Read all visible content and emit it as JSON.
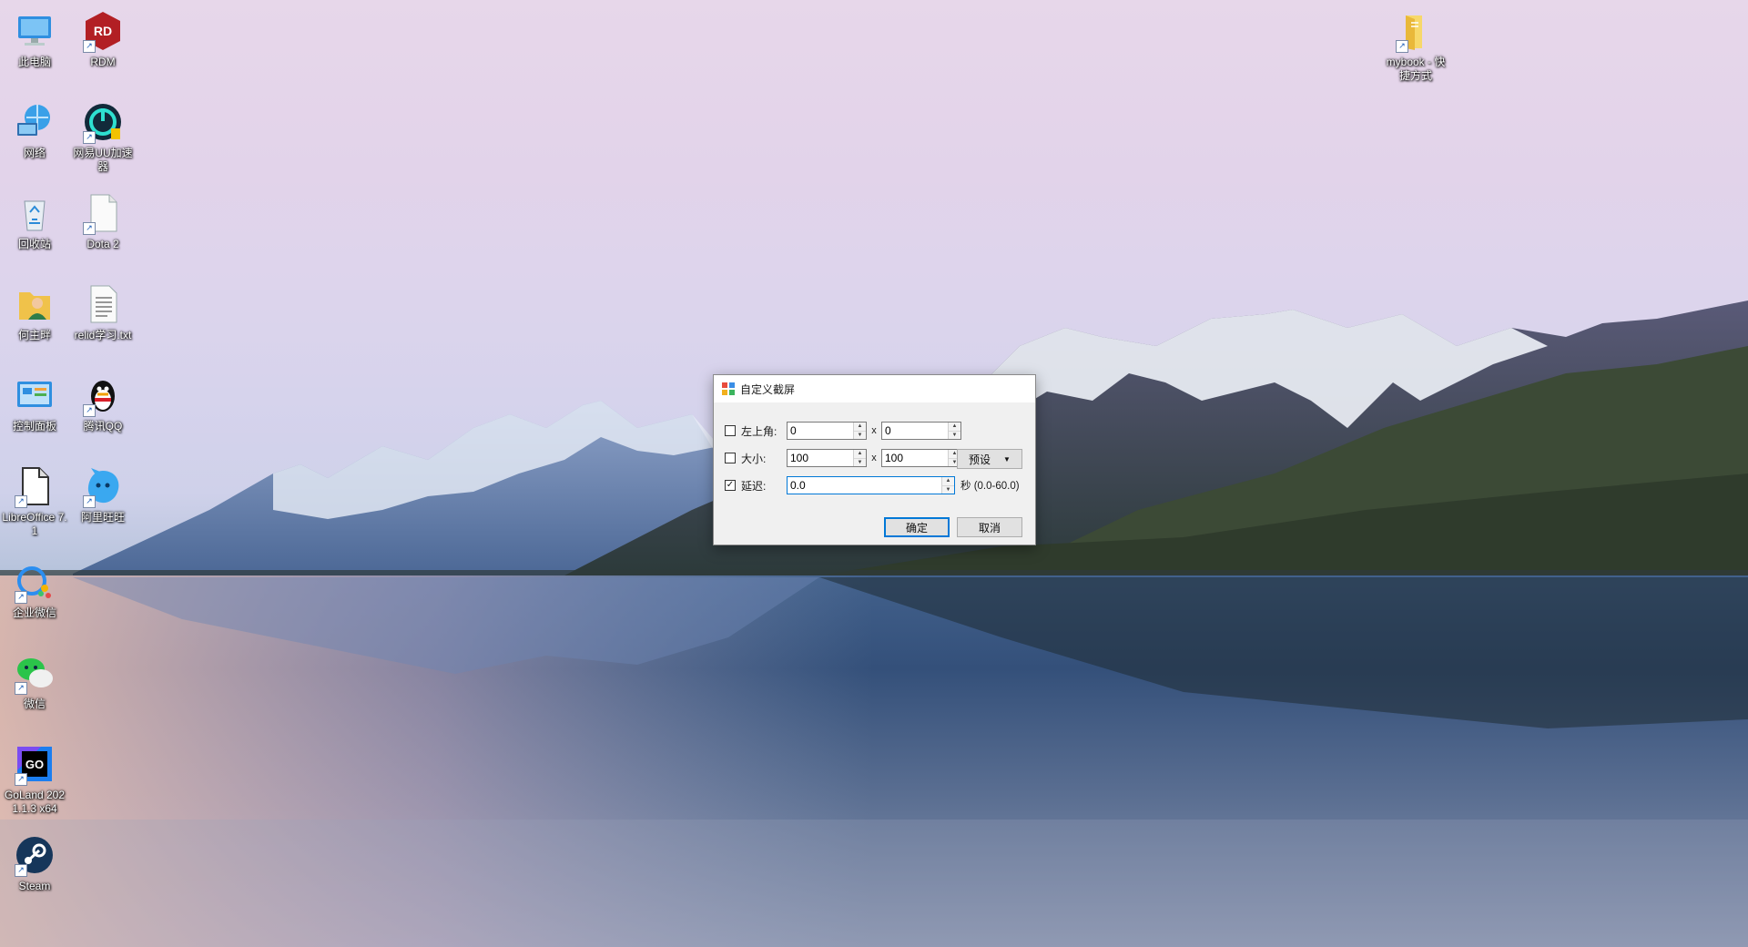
{
  "desktop": {
    "icons": [
      {
        "key": "this-pc",
        "label": "此电脑",
        "icon": "computer-icon",
        "shortcut": false
      },
      {
        "key": "rdm",
        "label": "RDM",
        "icon": "rdm-icon",
        "shortcut": true
      },
      {
        "key": "network",
        "label": "网络",
        "icon": "network-icon",
        "shortcut": false
      },
      {
        "key": "uu",
        "label": "网易UU加速器",
        "icon": "uu-accelerator-icon",
        "shortcut": true
      },
      {
        "key": "recycle-bin",
        "label": "回收站",
        "icon": "recycle-bin-icon",
        "shortcut": false
      },
      {
        "key": "dota2",
        "label": "Dota 2",
        "icon": "blank-file-icon",
        "shortcut": true
      },
      {
        "key": "user-folder",
        "label": "何主畔",
        "icon": "user-folder-icon",
        "shortcut": false
      },
      {
        "key": "relidx",
        "label": "relid学习.txt",
        "icon": "text-file-icon",
        "shortcut": false
      },
      {
        "key": "control-panel",
        "label": "控制面板",
        "icon": "control-panel-icon",
        "shortcut": false
      },
      {
        "key": "qq",
        "label": "腾讯QQ",
        "icon": "qq-penguin-icon",
        "shortcut": true
      },
      {
        "key": "libreoffice",
        "label": "LibreOffice 7.1",
        "icon": "libreoffice-icon",
        "shortcut": true
      },
      {
        "key": "aliwangwang",
        "label": "阿里旺旺",
        "icon": "aliwangwang-icon",
        "shortcut": true
      },
      {
        "key": "wecom",
        "label": "企业微信",
        "icon": "wecom-icon",
        "shortcut": true
      },
      {
        "key": "wechat",
        "label": "微信",
        "icon": "wechat-icon",
        "shortcut": true
      },
      {
        "key": "goland",
        "label": "GoLand 2021.1.3 x64",
        "icon": "goland-icon",
        "shortcut": true
      },
      {
        "key": "steam",
        "label": "Steam",
        "icon": "steam-icon",
        "shortcut": true
      },
      {
        "key": "mybook",
        "label": "mybook - 快捷方式",
        "icon": "folder-icon",
        "shortcut": true
      }
    ]
  },
  "dialog": {
    "title": "自定义截屏",
    "top_left": {
      "label": "左上角:",
      "checked": false,
      "x": "0",
      "y": "0"
    },
    "size": {
      "label": "大小:",
      "checked": false,
      "width": "100",
      "height": "100"
    },
    "delay": {
      "label": "延迟:",
      "checked": true,
      "value": "0.0",
      "hint": "秒 (0.0-60.0)"
    },
    "separator": "x",
    "preset_label": "预设",
    "ok_label": "确定",
    "cancel_label": "取消"
  }
}
